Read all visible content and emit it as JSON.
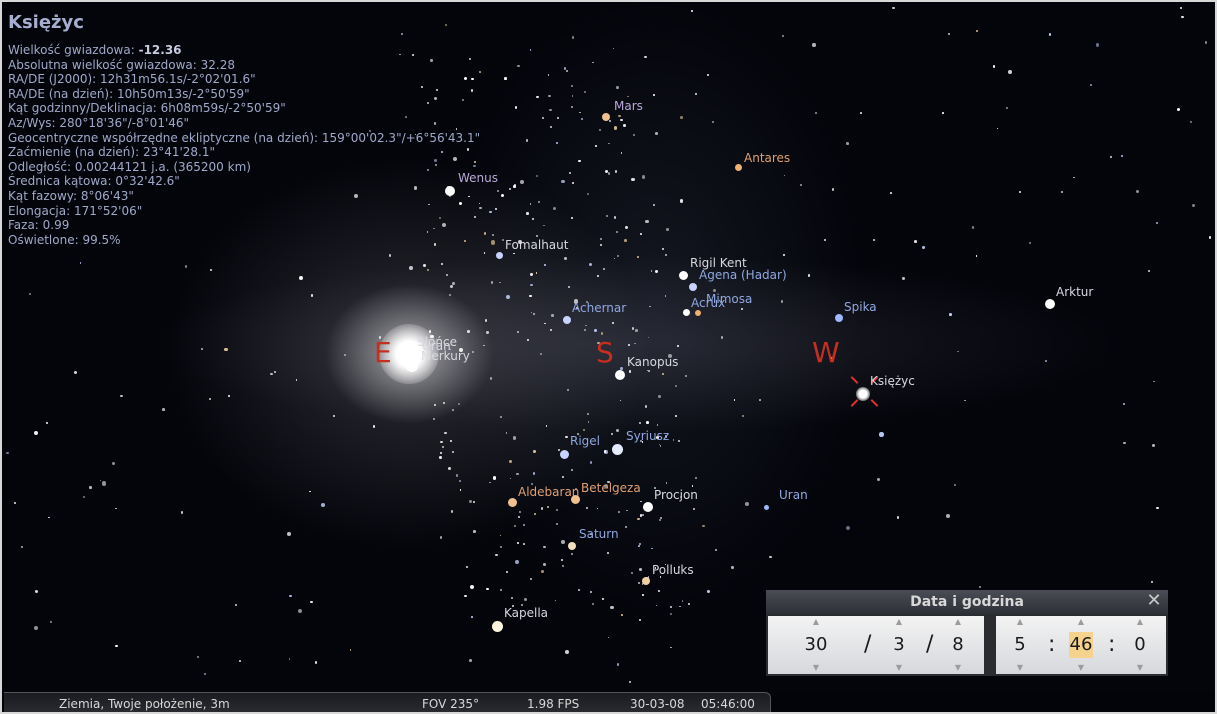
{
  "object_info": {
    "title": "Księżyc",
    "rows": [
      {
        "label": "Wielkość gwiazdowa: ",
        "value": "-12.36",
        "bold": true
      },
      {
        "label": "Absolutna wielkość gwiazdowa: 32.28",
        "value": ""
      },
      {
        "label": "RA/DE (J2000): 12h31m56.1s/-2°02'01.6\"",
        "value": ""
      },
      {
        "label": "RA/DE (na dzień): 10h50m13s/-2°50'59\"",
        "value": ""
      },
      {
        "label": "Kąt godzinny/Deklinacja: 6h08m59s/-2°50'59\"",
        "value": ""
      },
      {
        "label": "Az/Wys: 280°18'36\"/-8°01'46\"",
        "value": ""
      },
      {
        "label": "Geocentryczne współrzędne ekliptyczne (na dzień): 159°00'02.3\"/+6°56'43.1\"",
        "value": ""
      },
      {
        "label": "Zaćmienie (na dzień): 23°41'28.1\"",
        "value": ""
      },
      {
        "label": "Odległość: 0.00244121 j.a. (365200 km)",
        "value": ""
      },
      {
        "label": "Średnica kątowa: 0°32'42.6\"",
        "value": ""
      },
      {
        "label": "Kąt fazowy: 8°06'43\"",
        "value": ""
      },
      {
        "label": "Elongacja: 171°52'06\"",
        "value": ""
      },
      {
        "label": "Faza: 0.99",
        "value": ""
      },
      {
        "label": "Oświetlone: 99.5%",
        "value": ""
      }
    ]
  },
  "sky_labels": {
    "mars": "Mars",
    "antares": "Antares",
    "wenus": "Wenus",
    "fomalhaut": "Fomalhaut",
    "rigil_kent": "Rigil Kent",
    "agena": "Agena (Hadar)",
    "mimosa": "Mimosa",
    "acrux": "Acrux",
    "achernar": "Achernar",
    "spika": "Spika",
    "arktur": "Arktur",
    "slonce": "Słońce",
    "uran_label_sun": "Uran",
    "merkury": "Merkury",
    "kanopus": "Kanopus",
    "ksiezyc": "Księżyc",
    "rigel": "Rigel",
    "syriusz": "Syriusz",
    "aldebaran": "Aldebaran",
    "betelgeza": "Betelgeza",
    "procjon": "Procjon",
    "uran": "Uran",
    "saturn": "Saturn",
    "polluks": "Polluks",
    "kapella": "Kapella"
  },
  "cardinals": {
    "east": "E",
    "south": "S",
    "west": "W"
  },
  "datetime_dialog": {
    "title": "Data i godzina",
    "close_icon": "close-icon",
    "day": "30",
    "month": "3",
    "year": "8",
    "date_sep": "/",
    "hour": "5",
    "minute": "46",
    "second": "0",
    "time_sep": ":"
  },
  "status_bar": {
    "location": "Ziemia, Twoje położenie, 3m",
    "fov": "FOV 235°",
    "fps": "1.98 FPS",
    "date": "30-03-08",
    "time": "05:46:00"
  },
  "colors": {
    "cardinal": "#c42f20",
    "planet_label": "#b9a8d8",
    "blue_label": "#8fa8e0",
    "orange_label": "#e0a070",
    "dialog_highlight": "#f5d38f"
  }
}
